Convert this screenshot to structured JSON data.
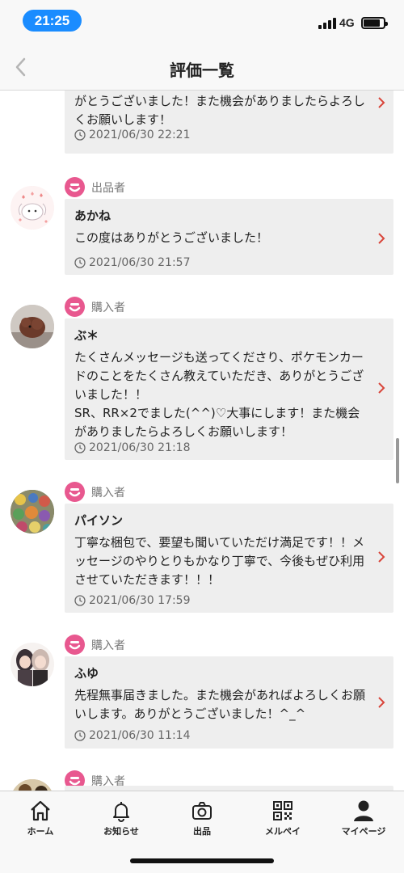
{
  "status": {
    "time": "21:25",
    "network": "4G"
  },
  "nav": {
    "title": "評価一覧"
  },
  "reviews": [
    {
      "name": "",
      "role": "",
      "message": "がとうございました！また機会がありましたらよろしくお願いします！",
      "date": "2021/06/30 22:21"
    },
    {
      "name": "あかね",
      "role": "出品者",
      "message": "この度はありがとうございました！",
      "date": "2021/06/30 21:57"
    },
    {
      "name": "ぶ＊",
      "role": "購入者",
      "message": "たくさんメッセージも送ってくださり、ポケモンカードのことをたくさん教えていただき、ありがとうございました！！\nSR、RR×2でました(^^)♡大事にします！また機会がありましたらよろしくお願いします！",
      "date": "2021/06/30 21:18"
    },
    {
      "name": "パイソン",
      "role": "購入者",
      "message": "丁寧な梱包で、要望も聞いていただけ満足です！！メッセージのやりとりもかなり丁寧で、今後もぜひ利用させていただきます！！！",
      "date": "2021/06/30 17:59"
    },
    {
      "name": "ふゆ",
      "role": "購入者",
      "message": "先程無事届きました。また機会があればよろしくお願いします。ありがとうございました！^_^",
      "date": "2021/06/30 11:14"
    },
    {
      "name": "",
      "role": "購入者",
      "message": "",
      "date": ""
    }
  ],
  "tabs": [
    {
      "label": "ホーム",
      "icon": "home-icon"
    },
    {
      "label": "お知らせ",
      "icon": "bell-icon"
    },
    {
      "label": "出品",
      "icon": "camera-icon"
    },
    {
      "label": "メルペイ",
      "icon": "qr-code-icon"
    },
    {
      "label": "マイページ",
      "icon": "person-icon"
    }
  ],
  "colors": {
    "accent": "#e8588f",
    "chevron": "#d9453a",
    "time_pill": "#1a8cff"
  }
}
